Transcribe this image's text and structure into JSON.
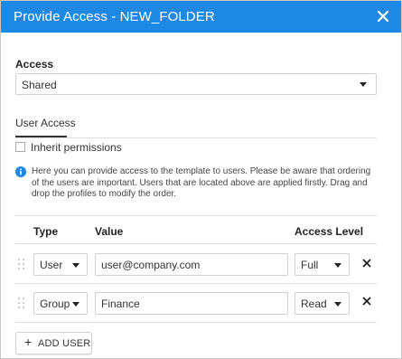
{
  "dialog": {
    "title": "Provide Access - NEW_FOLDER",
    "close_icon": "close-icon",
    "accent_color": "#1e88e5"
  },
  "access": {
    "label": "Access",
    "selected": "Shared"
  },
  "tabs": [
    {
      "label": "User Access",
      "active": true
    }
  ],
  "inherit": {
    "label": "Inherit permissions",
    "checked": false
  },
  "info": {
    "icon": "info-icon",
    "text": "Here you can provide access to the template to users. Please be aware that ordering of the users are important. Users that are located above are applied firstly. Drag and drop the profiles to modify the order."
  },
  "table": {
    "headers": {
      "type": "Type",
      "value": "Value",
      "access_level": "Access Level"
    },
    "rows": [
      {
        "type": "User",
        "value": "user@company.com",
        "access_level": "Full"
      },
      {
        "type": "Group",
        "value": "Finance",
        "access_level": "Read"
      }
    ]
  },
  "add_button": {
    "label": "ADD USER",
    "icon": "plus-icon"
  }
}
